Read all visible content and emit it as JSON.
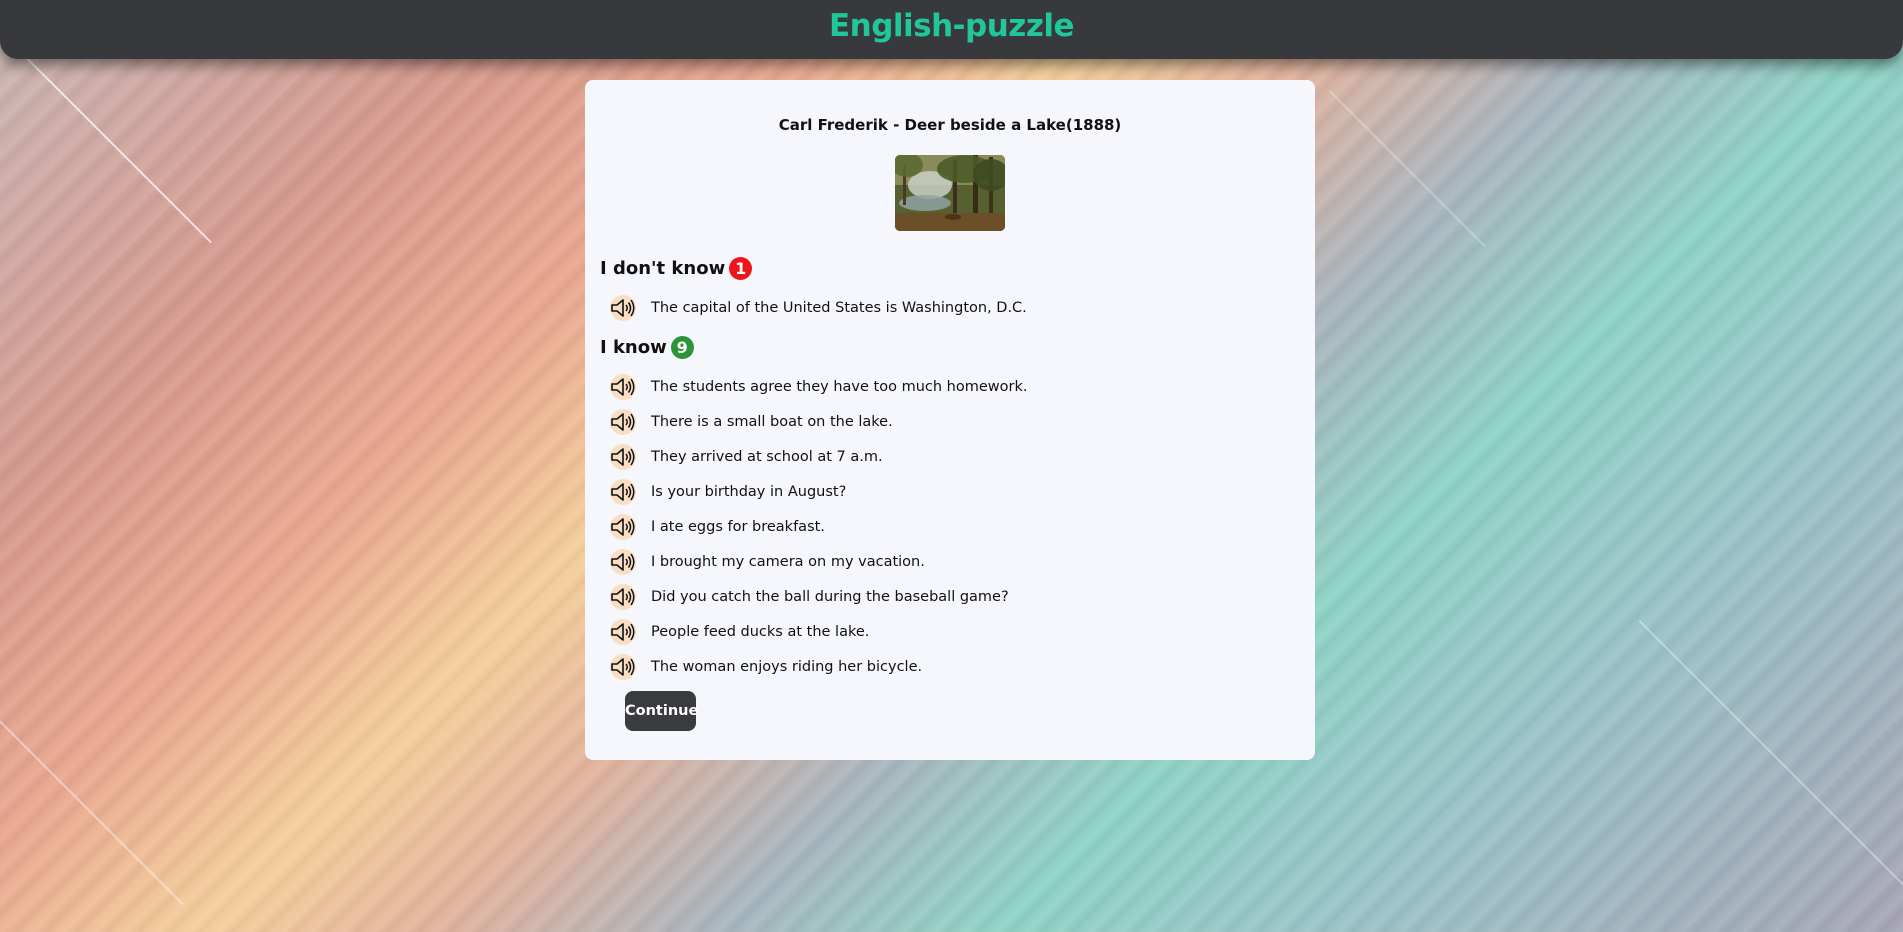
{
  "app": {
    "title": "English-puzzle",
    "title_color": "#1fc79a"
  },
  "picture": {
    "caption": "Carl Frederik - Deer beside a Lake(1888)"
  },
  "unknown_section": {
    "heading": "I don't know",
    "count": "1",
    "badge_color": "#f0151d",
    "sentences": [
      "The capital of the United States is Washington, D.C."
    ]
  },
  "known_section": {
    "heading": "I know",
    "count": "9",
    "badge_color": "#2a9436",
    "sentences": [
      "The students agree they have too much homework.",
      "There is a small boat on the lake.",
      "They arrived at school at 7 a.m.",
      "Is your birthday in August?",
      "I ate eggs for breakfast.",
      "I brought my camera on my vacation.",
      "Did you catch the ball during the baseball game?",
      "People feed ducks at the lake.",
      "The woman enjoys riding her bicycle."
    ]
  },
  "icons": {
    "audio": "speaker-icon"
  },
  "actions": {
    "continue_label": "Continue"
  }
}
